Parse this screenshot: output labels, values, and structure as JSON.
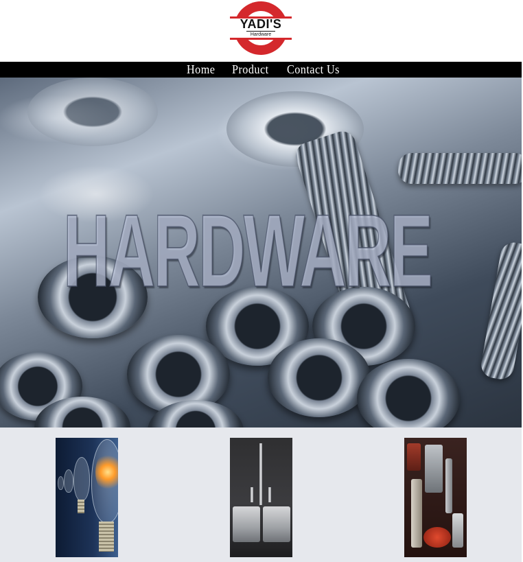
{
  "logo": {
    "name": "YADI'S",
    "subtitle": "Hardware"
  },
  "nav": {
    "items": [
      {
        "label": "Home"
      },
      {
        "label": "Product"
      },
      {
        "label": "Contact Us"
      }
    ]
  },
  "hero": {
    "word": "HARDWARE"
  },
  "products": {
    "items": [
      {
        "image": "light-bulbs"
      },
      {
        "image": "stainless-sink"
      },
      {
        "image": "power-tools"
      }
    ]
  },
  "colors": {
    "nav_background": "#000000",
    "logo_red": "#d4282c",
    "product_strip_background": "#e6e8ed"
  }
}
